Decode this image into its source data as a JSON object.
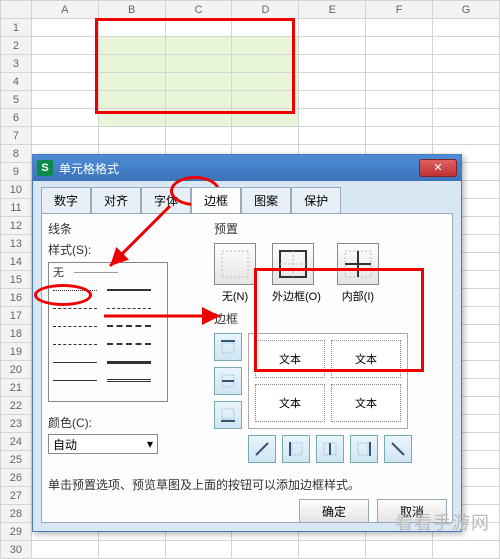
{
  "sheet": {
    "columns": [
      "A",
      "B",
      "C",
      "D",
      "E",
      "F",
      "G"
    ],
    "rows": [
      "1",
      "2",
      "3",
      "4",
      "5",
      "6",
      "7",
      "8",
      "9",
      "10",
      "11",
      "12",
      "13",
      "14",
      "15",
      "16",
      "17",
      "18",
      "19",
      "20",
      "21",
      "22",
      "23",
      "24",
      "25",
      "26",
      "27",
      "28",
      "29",
      "30"
    ]
  },
  "dialog": {
    "title": "单元格格式",
    "tabs": [
      "数字",
      "对齐",
      "字体",
      "边框",
      "图案",
      "保护"
    ],
    "active_tab": "边框",
    "line": {
      "label": "线条",
      "style_label": "样式(S):",
      "none_label": "无",
      "color_label": "颜色(C):",
      "color_value": "自动"
    },
    "preset": {
      "label": "预置",
      "items": [
        {
          "name": "none",
          "label": "无(N)"
        },
        {
          "name": "outline",
          "label": "外边框(O)"
        },
        {
          "name": "inside",
          "label": "内部(I)"
        }
      ]
    },
    "border": {
      "label": "边框",
      "sample_text": "文本"
    },
    "hint": "单击预置选项、预览草图及上面的按钮可以添加边框样式。",
    "buttons": {
      "ok": "确定",
      "cancel": "取消"
    }
  },
  "watermark": "看看手游网"
}
